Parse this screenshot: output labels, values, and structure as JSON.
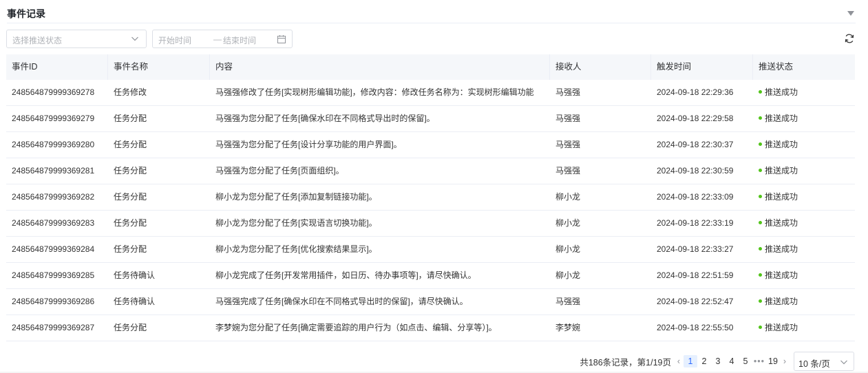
{
  "header": {
    "title": "事件记录"
  },
  "filters": {
    "status_placeholder": "选择推送状态",
    "start_placeholder": "开始时间",
    "separator": "—",
    "end_placeholder": "结束时间"
  },
  "table": {
    "columns": [
      "事件ID",
      "事件名称",
      "内容",
      "接收人",
      "触发时间",
      "推送状态"
    ],
    "rows": [
      [
        "248564879999369278",
        "任务修改",
        "马强强修改了任务[实现树形编辑功能]，修改内容：修改任务名称为：实现树形编辑功能",
        "马强强",
        "2024-09-18 22:29:36",
        "推送成功"
      ],
      [
        "248564879999369279",
        "任务分配",
        "马强强为您分配了任务[确保水印在不同格式导出时的保留]。",
        "马强强",
        "2024-09-18 22:29:58",
        "推送成功"
      ],
      [
        "248564879999369280",
        "任务分配",
        "马强强为您分配了任务[设计分享功能的用户界面]。",
        "马强强",
        "2024-09-18 22:30:37",
        "推送成功"
      ],
      [
        "248564879999369281",
        "任务分配",
        "马强强为您分配了任务[页面组织]。",
        "马强强",
        "2024-09-18 22:30:59",
        "推送成功"
      ],
      [
        "248564879999369282",
        "任务分配",
        "柳小龙为您分配了任务[添加复制链接功能]。",
        "柳小龙",
        "2024-09-18 22:33:09",
        "推送成功"
      ],
      [
        "248564879999369283",
        "任务分配",
        "柳小龙为您分配了任务[实现语言切换功能]。",
        "柳小龙",
        "2024-09-18 22:33:19",
        "推送成功"
      ],
      [
        "248564879999369284",
        "任务分配",
        "柳小龙为您分配了任务[优化搜索结果显示]。",
        "柳小龙",
        "2024-09-18 22:33:27",
        "推送成功"
      ],
      [
        "248564879999369285",
        "任务待确认",
        "柳小龙完成了任务[开发常用插件，如日历、待办事项等]，请尽快确认。",
        "柳小龙",
        "2024-09-18 22:51:59",
        "推送成功"
      ],
      [
        "248564879999369286",
        "任务待确认",
        "马强强完成了任务[确保水印在不同格式导出时的保留]，请尽快确认。",
        "马强强",
        "2024-09-18 22:52:47",
        "推送成功"
      ],
      [
        "248564879999369287",
        "任务分配",
        "李梦婉为您分配了任务[确定需要追踪的用户行为（如点击、编辑、分享等）]。",
        "李梦婉",
        "2024-09-18 22:55:50",
        "推送成功"
      ]
    ],
    "status_color": "#52c41a"
  },
  "pagination": {
    "summary": "共186条记录，第1/19页",
    "pages": [
      "1",
      "2",
      "3",
      "4",
      "5"
    ],
    "ellipsis": "•••",
    "last_page": "19",
    "current": "1",
    "page_size": "10 条/页"
  },
  "colors": {
    "accent": "#2f6bff",
    "header_bg": "#f5f7fa"
  }
}
